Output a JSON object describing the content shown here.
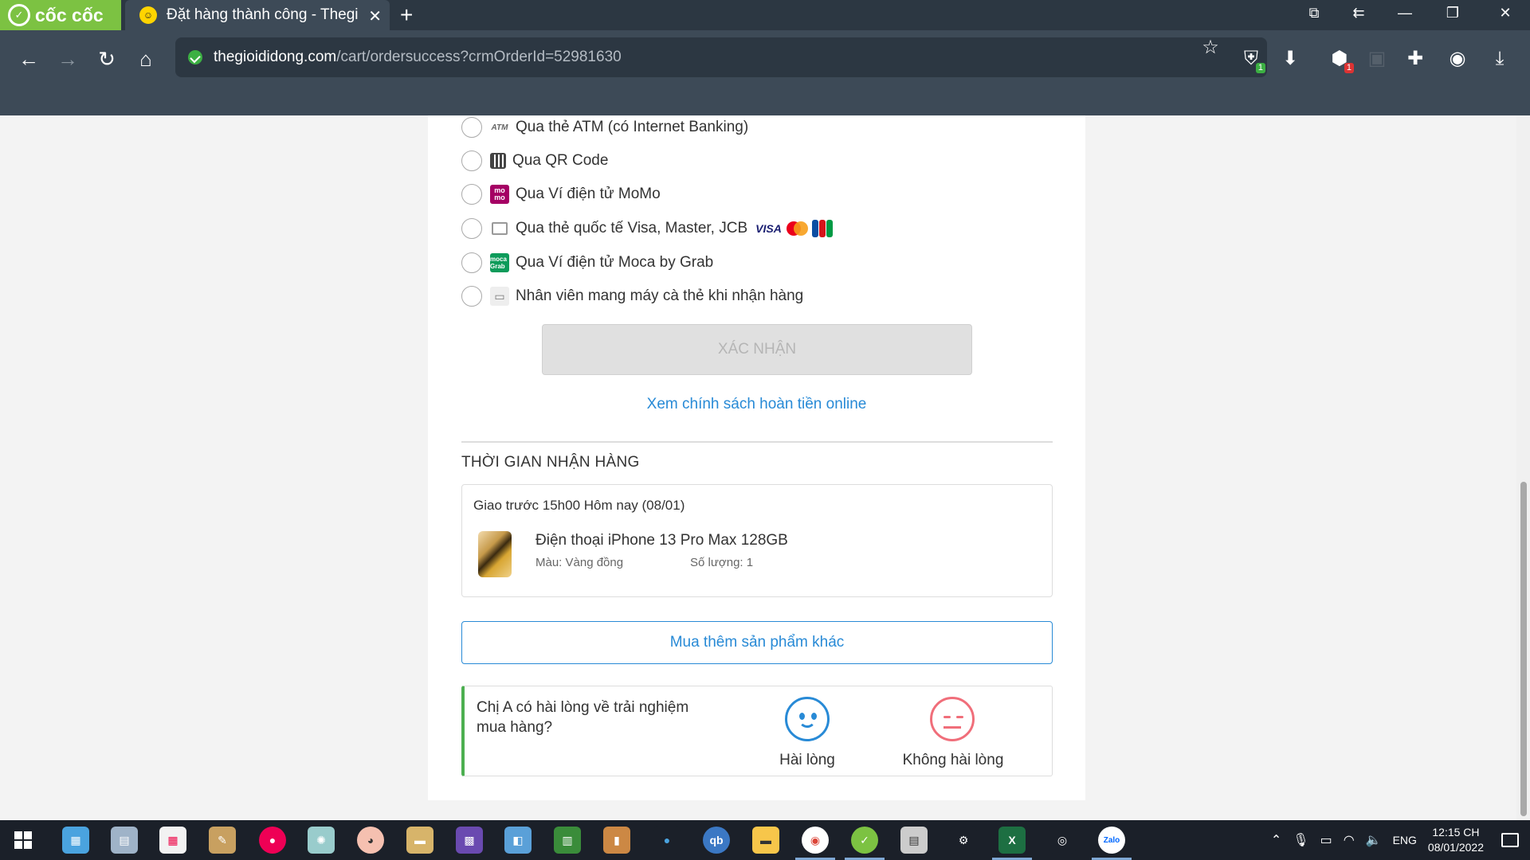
{
  "browser": {
    "brand": "cốc cốc",
    "tab_title": "Đặt hàng thành công - Thegi",
    "new_tab_glyph": "+",
    "url_domain": "thegioididong.com",
    "url_path": "/cart/ordersuccess?crmOrderId=52981630",
    "badge_1": "1",
    "badge_2": "1"
  },
  "payment_methods": [
    {
      "icon": "ATM",
      "label": "Qua thẻ ATM (có Internet Banking)"
    },
    {
      "icon": "qr-code-icon",
      "label": "Qua QR Code"
    },
    {
      "icon": "mo mo",
      "label": "Qua Ví điện tử MoMo"
    },
    {
      "icon": "credit-card-icon",
      "label": "Qua thẻ quốc tế Visa, Master, JCB"
    },
    {
      "icon": "moca Grab",
      "label": "Qua Ví điện tử Moca by Grab"
    },
    {
      "icon": "card-reader-icon",
      "label": "Nhân viên mang máy cà thẻ khi nhận hàng"
    }
  ],
  "card_logos": {
    "visa": "VISA",
    "master": "MASTER"
  },
  "confirm_button": "XÁC NHẬN",
  "refund_link": "Xem chính sách hoàn tiền online",
  "delivery": {
    "title": "THỜI GIAN NHẬN HÀNG",
    "time": "Giao trước 15h00 Hôm nay (08/01)",
    "product_name": "Điện thoại iPhone 13 Pro Max 128GB",
    "product_color": "Màu: Vàng đồng",
    "product_qty": "Số lượng: 1"
  },
  "buy_more_button": "Mua thêm sản phẩm khác",
  "survey": {
    "question": "Chị A có hài lòng về trải nghiệm mua hàng?",
    "satisfied": "Hài lòng",
    "unsatisfied": "Không hài lòng"
  },
  "taskbar": {
    "apps": [
      "qb",
      "Zalo"
    ],
    "lang": "ENG",
    "time": "12:15 CH",
    "date": "08/01/2022"
  },
  "colors": {
    "accent": "#288ad6",
    "brand_green": "#7cc242",
    "survey_bar": "#4caf50",
    "unhappy": "#f06e7a"
  }
}
